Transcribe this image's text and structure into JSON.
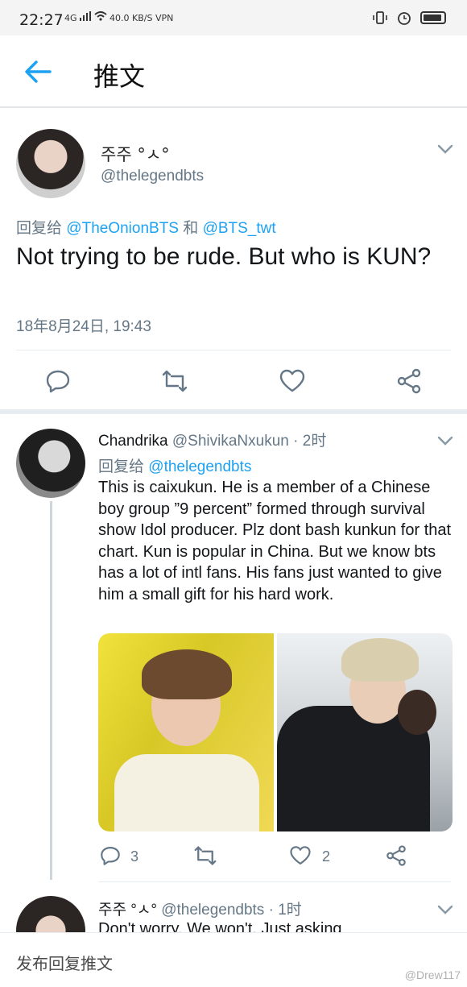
{
  "status_bar": {
    "time": "22:27",
    "network": "4G",
    "speed": "40.0 KB/S",
    "vpn": "VPN"
  },
  "app_bar": {
    "title": "推文"
  },
  "main_tweet": {
    "display_name": "주주 °ㅅ°",
    "handle": "@thelegendbts",
    "reply_prefix": "回复给",
    "reply_user_1": "@TheOnionBTS",
    "reply_join": "和",
    "reply_user_2": "@BTS_twt",
    "text": "Not trying to be rude. But who is KUN?",
    "timestamp": "18年8月24日, 19:43"
  },
  "reply_tweet": {
    "display_name": "Chandrika",
    "handle": "@ShivikaNxukun",
    "time": "· 2时",
    "reply_prefix": "回复给",
    "reply_user": "@thelegendbts",
    "text": "This is caixukun. He is a member of a Chinese boy group ”9 percent” formed through survival show Idol producer. Plz dont bash kunkun for that chart. Kun is popular in China. But we know bts has a lot of intl fans. His fans just wanted to give him a small gift for his hard work.",
    "reply_count": "3",
    "like_count": "2"
  },
  "third_tweet": {
    "display_name": "주주 °ㅅ°",
    "handle": "@thelegendbts",
    "time": "· 1时",
    "text": "Don't worry. We won't. Just asking"
  },
  "composer": {
    "placeholder": "发布回复推文"
  },
  "watermark": "@Drew117",
  "colors": {
    "accent": "#1da1f2",
    "secondary_text": "#657786",
    "divider": "#e6ecf0"
  }
}
